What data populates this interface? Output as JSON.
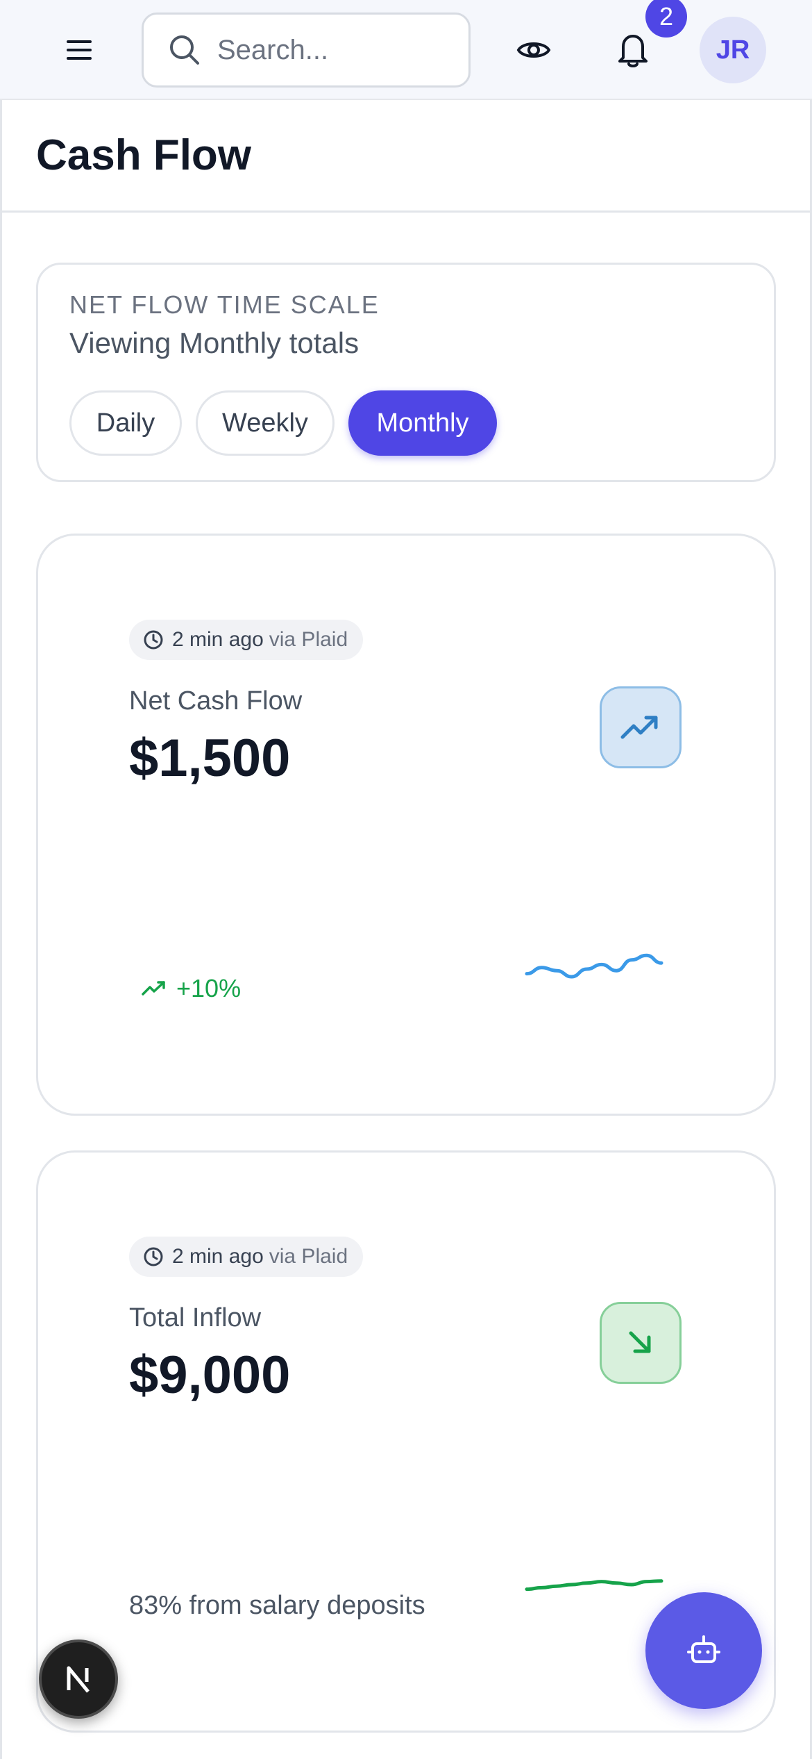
{
  "topbar": {
    "search": {
      "placeholder": "Search..."
    },
    "notifications": {
      "count": "2"
    },
    "user": {
      "initials": "JR"
    },
    "icons": [
      "menu-icon",
      "search-icon",
      "eye-icon",
      "bell-icon"
    ]
  },
  "page": {
    "title": "Cash Flow"
  },
  "time_scale": {
    "eyebrow": "NET FLOW TIME SCALE",
    "subtitle": "Viewing Monthly totals",
    "options": [
      "Daily",
      "Weekly",
      "Monthly"
    ],
    "selected": "Monthly"
  },
  "cards": [
    {
      "updated": "2 min ago",
      "source": "via Plaid",
      "label": "Net Cash Flow",
      "value": "$1,500",
      "icon": "trending-up-icon",
      "trend": "+10%",
      "sparkline_color": "#3b9ae8",
      "sparkline": [
        0.35,
        0.55,
        0.45,
        0.25,
        0.5,
        0.65,
        0.45,
        0.8,
        0.95,
        0.7
      ]
    },
    {
      "updated": "2 min ago",
      "source": "via Plaid",
      "label": "Total Inflow",
      "value": "$9,000",
      "icon": "arrow-down-right-icon",
      "note": "83% from salary deposits",
      "sparkline_color": "#16a34a",
      "sparkline": [
        0.35,
        0.4,
        0.45,
        0.5,
        0.55,
        0.6,
        0.55,
        0.5,
        0.6,
        0.62
      ]
    }
  ],
  "colors": {
    "accent": "#4f46e5",
    "positive": "#16a34a",
    "info": "#3b9ae8"
  },
  "fab": {
    "icon": "robot-icon"
  },
  "dev_badge": {
    "icon": "nextjs-icon"
  }
}
